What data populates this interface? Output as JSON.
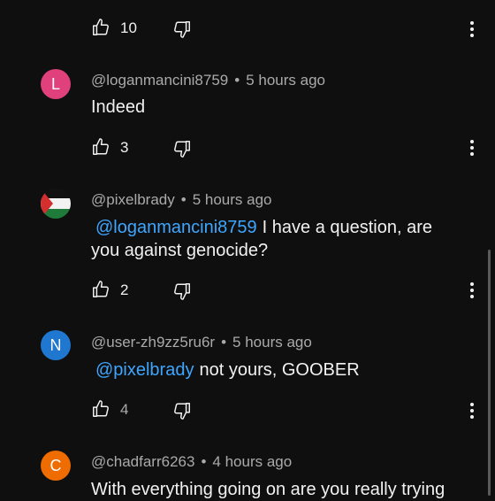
{
  "comments": [
    {
      "like_count": "10"
    },
    {
      "author": "@loganmancini8759",
      "time": "5 hours ago",
      "avatar_letter": "L",
      "avatar_color": "#e0407b",
      "text": "Indeed",
      "like_count": "3"
    },
    {
      "author": "@pixelbrady",
      "time": "5 hours ago",
      "avatar_letter": "",
      "avatar_color": "#2b2b2b",
      "mention": "@loganmancini8759",
      "text_line1": "I have a question, are",
      "text_line2": "you against genocide?",
      "like_count": "2"
    },
    {
      "author": "@user-zh9zz5ru6r",
      "time": "5 hours ago",
      "avatar_letter": "N",
      "avatar_color": "#1f77d0",
      "mention": "@pixelbrady",
      "text": "not yours, GOOBER",
      "like_count": "4"
    },
    {
      "author": "@chadfarr6263",
      "time": "4 hours ago",
      "avatar_letter": "C",
      "avatar_color": "#ef6c00",
      "text": "With everything going on are you really trying"
    }
  ],
  "separator": "•",
  "icons": {
    "like": "thumbs-up-icon",
    "dislike": "thumbs-down-icon",
    "more": "more-vert-icon"
  }
}
